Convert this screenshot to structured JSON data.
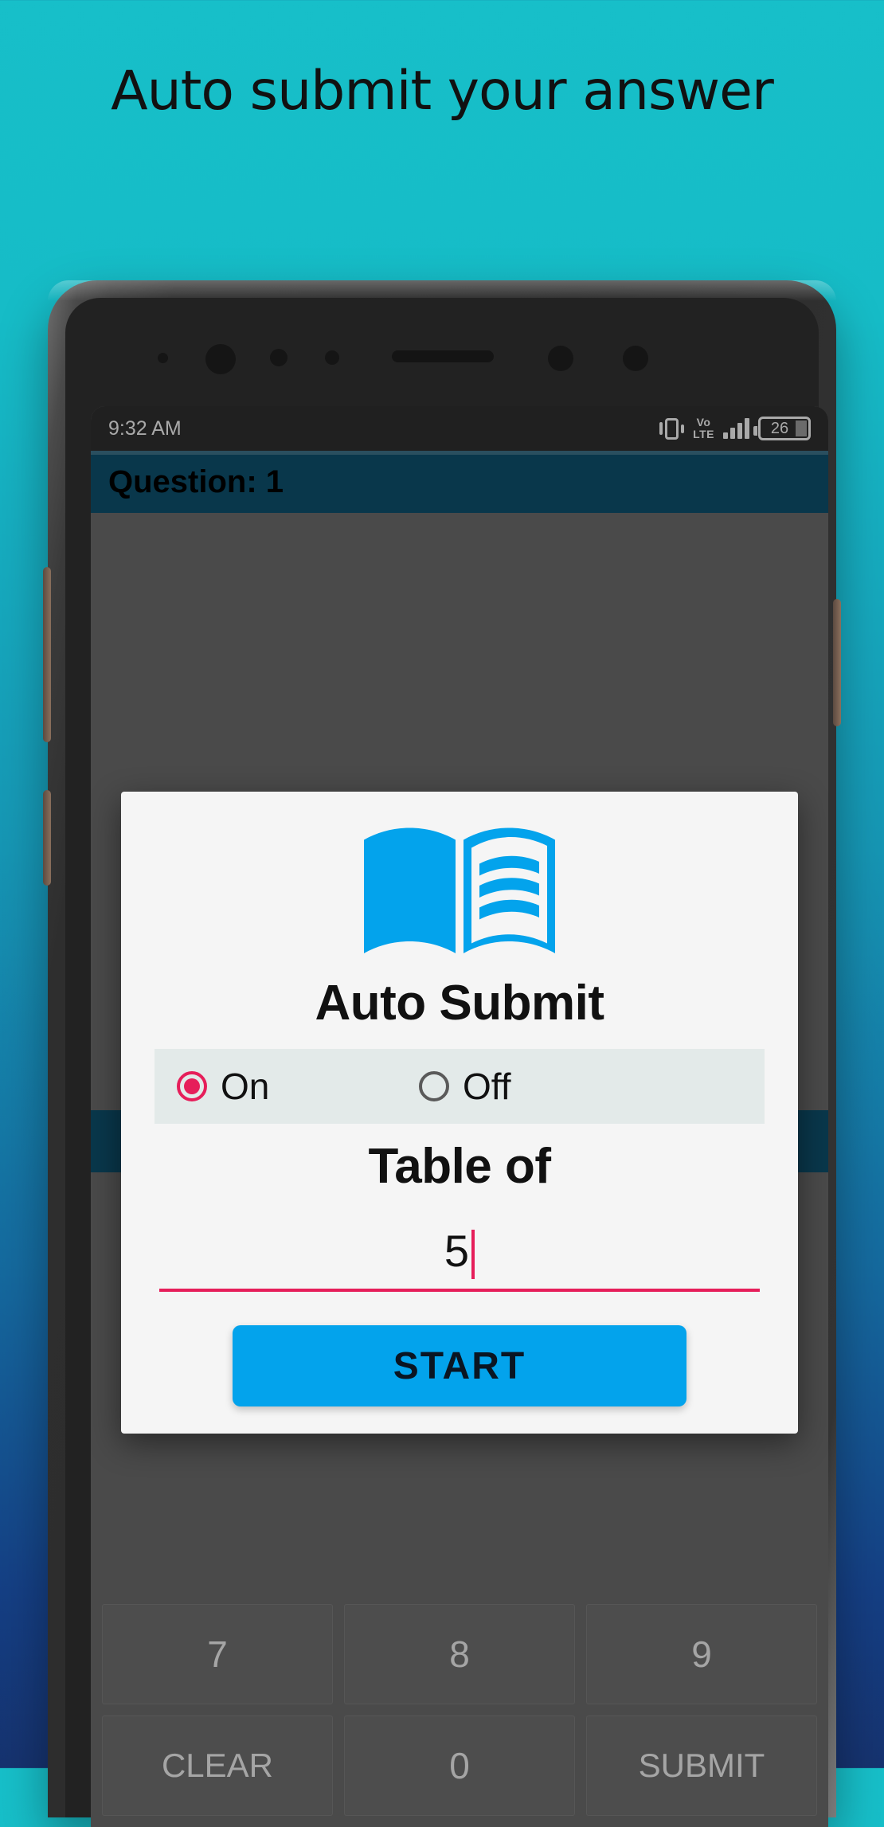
{
  "promo": {
    "headline": "Auto submit your answer",
    "background_top": "#17BFC9",
    "background_bottom": "#16336F"
  },
  "status_bar": {
    "time": "9:32 AM",
    "vibrate_icon": "vibrate-icon",
    "network_label": "Vo\nLTE",
    "network_line1": "Vo",
    "network_line2": "LTE",
    "signal_icon": "signal-bars-icon",
    "battery_level": "26"
  },
  "app_bar": {
    "title": "Question: 1",
    "background": "#0d4f6c"
  },
  "dialog": {
    "icon": "open-book-icon",
    "icon_color": "#03A3EC",
    "title": "Auto Submit",
    "auto_submit": {
      "selected": "On",
      "options": [
        {
          "label": "On",
          "checked": true
        },
        {
          "label": "Off",
          "checked": false
        }
      ],
      "accent_color": "#E61E5A"
    },
    "table_label": "Table of",
    "table_input": {
      "value": "5",
      "placeholder": ""
    },
    "start_label": "START",
    "start_color": "#03A3EC"
  },
  "keypad": {
    "keys": [
      "7",
      "8",
      "9",
      "CLEAR",
      "0",
      "SUBMIT"
    ]
  }
}
